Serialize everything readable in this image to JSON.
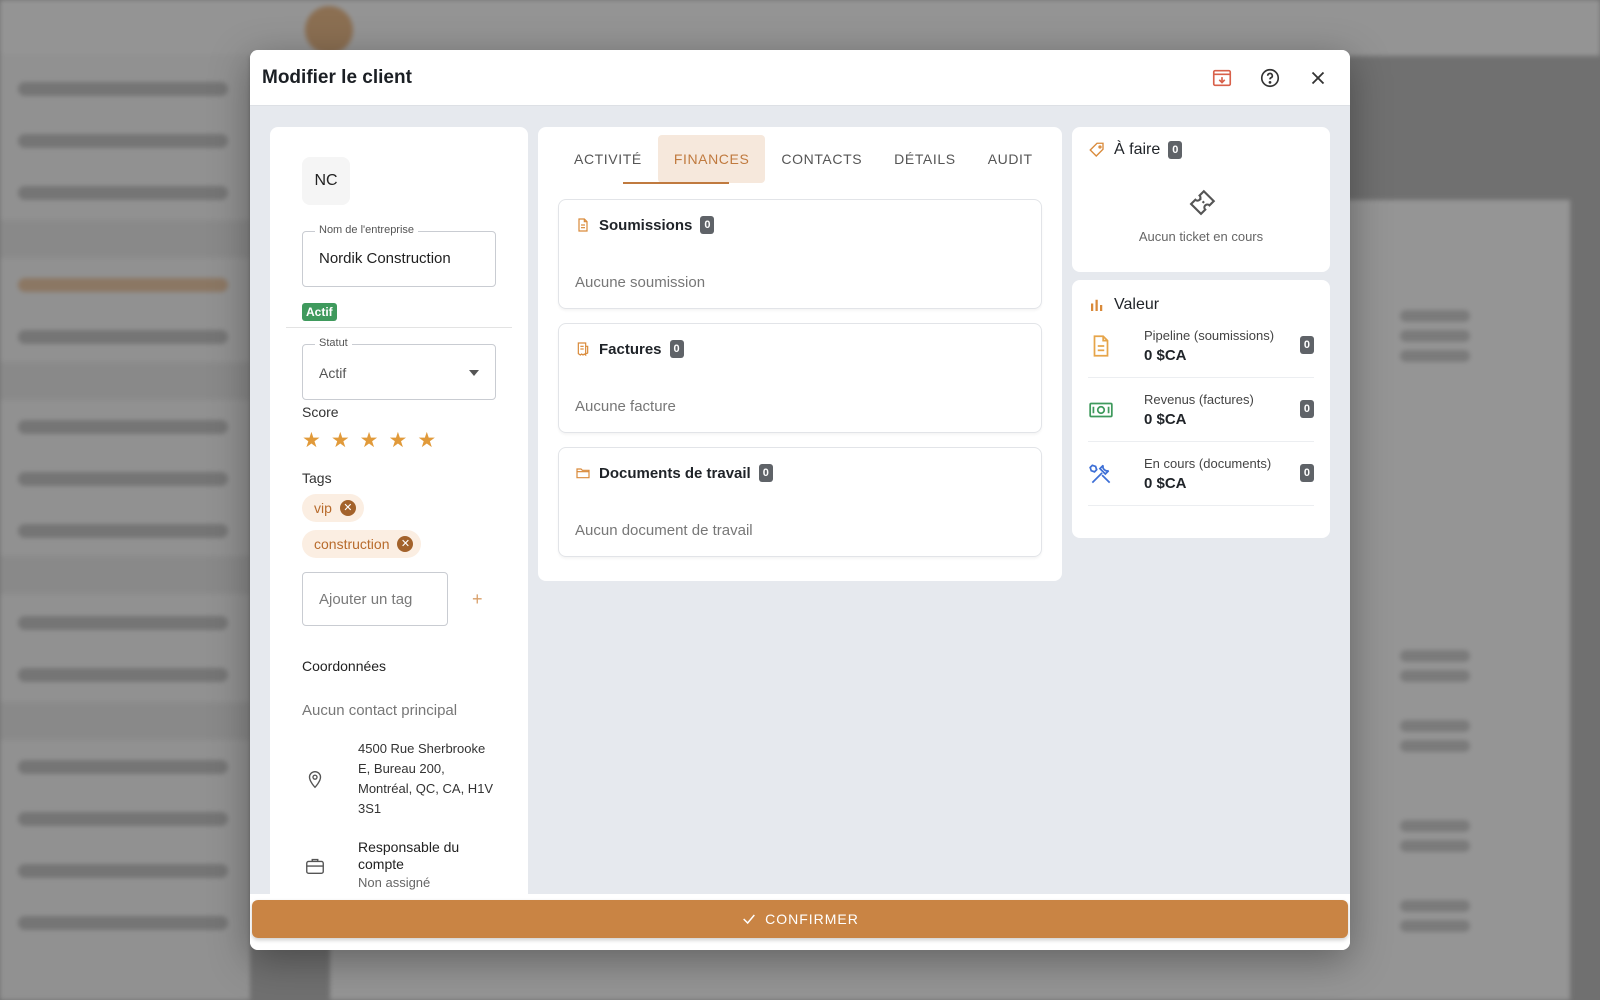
{
  "modal": {
    "title": "Modifier le client",
    "header_icons": [
      "archive-icon",
      "help-circle-icon",
      "close-icon"
    ]
  },
  "client": {
    "initials": "NC",
    "company_label": "Nom de l'entreprise",
    "company_name": "Nordik Construction",
    "status_badge": "Actif",
    "status_label": "Statut",
    "status_value": "Actif",
    "score_label": "Score",
    "score": 5,
    "score_max": 5,
    "tags_label": "Tags",
    "tags": [
      "vip",
      "construction"
    ],
    "add_tag_placeholder": "Ajouter un tag",
    "add_tag_button": "+",
    "coords_label": "Coordonnées",
    "no_contact": "Aucun contact principal",
    "address": "4500 Rue Sherbrooke E, Bureau 200, Montréal, QC, CA, H1V 3S1",
    "account_manager_label": "Responsable du compte",
    "account_manager_value": "Non assigné"
  },
  "tabs": [
    {
      "label": "ACTIVITÉ",
      "active": false
    },
    {
      "label": "FINANCES",
      "active": true
    },
    {
      "label": "CONTACTS",
      "active": false
    },
    {
      "label": "DÉTAILS",
      "active": false
    },
    {
      "label": "AUDIT",
      "active": false
    }
  ],
  "finances": [
    {
      "title": "Soumissions",
      "count": "0",
      "empty": "Aucune soumission",
      "icon": "document-icon"
    },
    {
      "title": "Factures",
      "count": "0",
      "empty": "Aucune facture",
      "icon": "invoice-icon"
    },
    {
      "title": "Documents de travail",
      "count": "0",
      "empty": "Aucun document de travail",
      "icon": "folder-icon"
    }
  ],
  "todo": {
    "title": "À faire",
    "count": "0",
    "empty": "Aucun ticket en cours"
  },
  "value": {
    "title": "Valeur",
    "rows": [
      {
        "label": "Pipeline (soumissions)",
        "amount": "0 $CA",
        "count": "0",
        "icon": "document-icon"
      },
      {
        "label": "Revenus (factures)",
        "amount": "0 $CA",
        "count": "0",
        "icon": "cash-icon"
      },
      {
        "label": "En cours (documents)",
        "amount": "0 $CA",
        "count": "0",
        "icon": "tools-icon"
      }
    ]
  },
  "footer": {
    "confirm_label": "CONFIRMER"
  },
  "colors": {
    "accent": "#c98444",
    "active_badge": "#3f9a5d",
    "star": "#e19a3a",
    "tag_bg": "#fbeee2"
  }
}
